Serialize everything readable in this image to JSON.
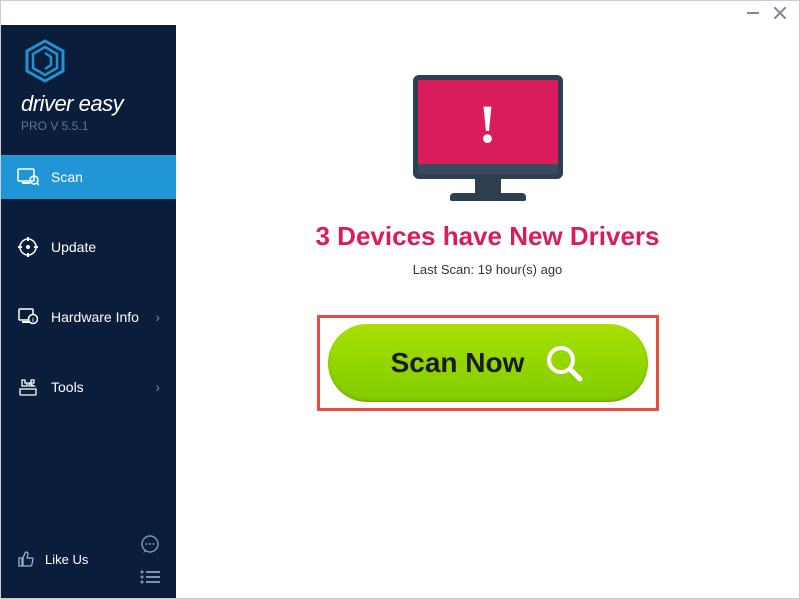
{
  "app": {
    "title": "driver easy",
    "version": "PRO V 5.5.1"
  },
  "sidebar": {
    "items": [
      {
        "label": "Scan",
        "icon": "scan-icon",
        "has_chevron": false,
        "active": true
      },
      {
        "label": "Update",
        "icon": "update-icon",
        "has_chevron": false,
        "active": false
      },
      {
        "label": "Hardware Info",
        "icon": "hardware-icon",
        "has_chevron": true,
        "active": false
      },
      {
        "label": "Tools",
        "icon": "tools-icon",
        "has_chevron": true,
        "active": false
      }
    ],
    "bottom": {
      "like_label": "Like Us"
    }
  },
  "main": {
    "headline": "3 Devices have New Drivers",
    "last_scan": "Last Scan: 19 hour(s) ago",
    "scan_button": "Scan Now"
  },
  "colors": {
    "sidebar_bg": "#0a1e3c",
    "sidebar_active": "#2196d6",
    "accent_pink": "#d91c5c",
    "scan_green": "#93d600",
    "highlight_red": "#e74c3c"
  }
}
